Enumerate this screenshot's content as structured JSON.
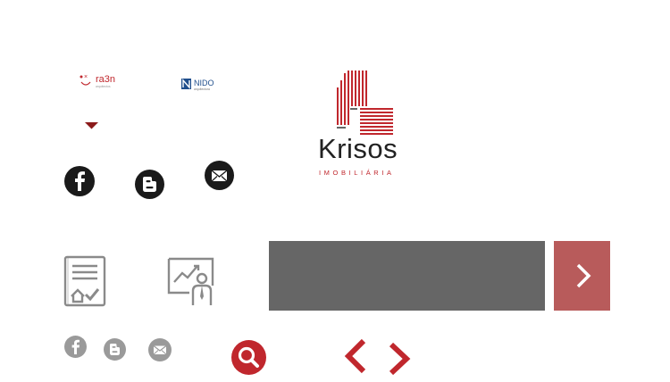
{
  "brand": {
    "name": "Krisos",
    "tagline": "IMOBILIÁRIA",
    "color": "#c0272d"
  },
  "partners": [
    {
      "name": "ra3n",
      "sub": "arquitectos",
      "icon": "ra3n-logo"
    },
    {
      "name": "NIDO",
      "sub": "arquitectura",
      "icon": "nido-logo"
    }
  ],
  "social_large": [
    {
      "icon": "facebook-icon"
    },
    {
      "icon": "blogger-icon"
    },
    {
      "icon": "email-icon"
    }
  ],
  "social_small": [
    {
      "icon": "facebook-icon"
    },
    {
      "icon": "blogger-icon"
    },
    {
      "icon": "email-icon"
    }
  ],
  "feature_icons": [
    {
      "icon": "property-document-icon"
    },
    {
      "icon": "business-chart-presenter-icon"
    }
  ],
  "search": {
    "icon": "search-icon",
    "color": "#c0272d"
  },
  "nav": {
    "prev_icon": "chevron-left-icon",
    "next_icon": "chevron-right-icon"
  },
  "colors": {
    "accent": "#c0272d",
    "panel": "#666666",
    "next_button": "#b85b5b",
    "icon_dark": "#1a1a1a",
    "icon_grey": "#9a9a9a"
  }
}
